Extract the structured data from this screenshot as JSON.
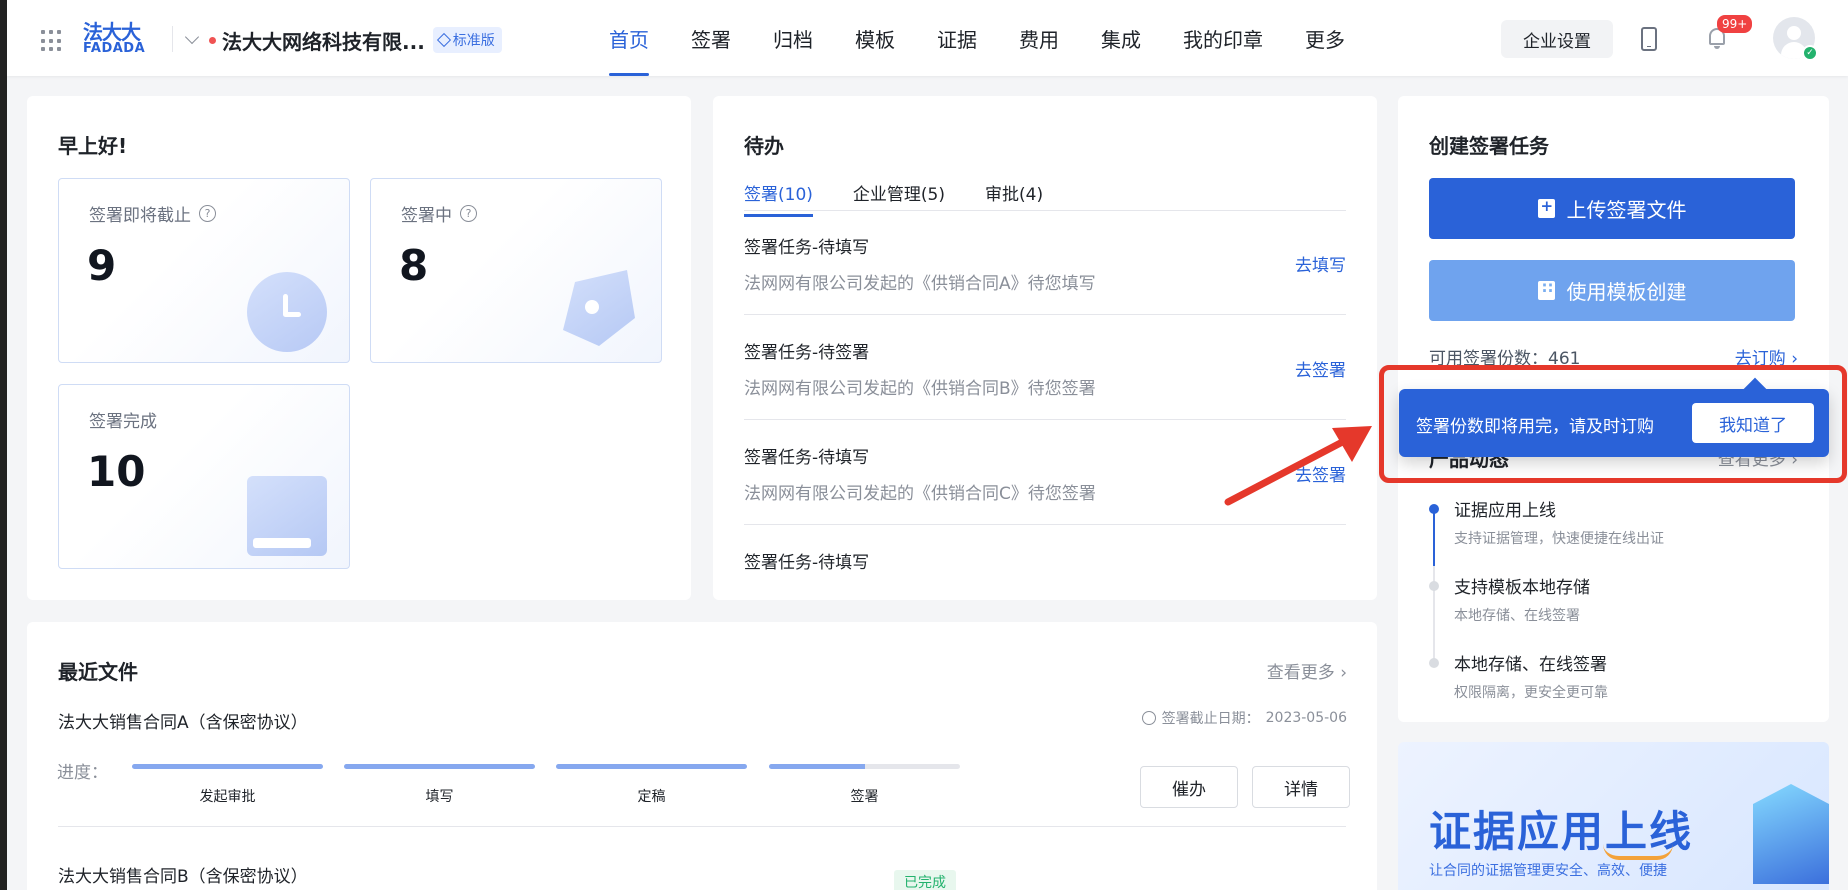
{
  "header": {
    "logo": {
      "cn": "法大大",
      "en": "FADADA"
    },
    "company_name": "法大大网络科技有限...",
    "edition_badge": "标准版",
    "nav": [
      {
        "label": "首页",
        "active": true
      },
      {
        "label": "签署",
        "active": false
      },
      {
        "label": "归档",
        "active": false
      },
      {
        "label": "模板",
        "active": false
      },
      {
        "label": "证据",
        "active": false
      },
      {
        "label": "费用",
        "active": false
      },
      {
        "label": "集成",
        "active": false
      },
      {
        "label": "我的印章",
        "active": false
      },
      {
        "label": "更多",
        "active": false
      }
    ],
    "settings_label": "企业设置",
    "notification_count": "99+"
  },
  "greeting": {
    "title": "早上好!",
    "stats": [
      {
        "label": "签署即将截止",
        "value": "9",
        "help": true
      },
      {
        "label": "签署中",
        "value": "8",
        "help": true
      },
      {
        "label": "签署完成",
        "value": "10",
        "help": false
      }
    ],
    "help_glyph": "?"
  },
  "todo": {
    "title": "待办",
    "tabs": [
      {
        "label": "签署(10)",
        "active": true
      },
      {
        "label": "企业管理(5)",
        "active": false
      },
      {
        "label": "审批(4)",
        "active": false
      }
    ],
    "items": [
      {
        "title": "签署任务-待填写",
        "desc": "法网网有限公司发起的《供销合同A》待您填写",
        "action": "去填写"
      },
      {
        "title": "签署任务-待签署",
        "desc": "法网网有限公司发起的《供销合同B》待您签署",
        "action": "去签署"
      },
      {
        "title": "签署任务-待填写",
        "desc": "法网网有限公司发起的《供销合同C》待您签署",
        "action": "去签署"
      },
      {
        "title": "签署任务-待填写",
        "desc": "",
        "action": ""
      }
    ]
  },
  "create": {
    "title": "创建签署任务",
    "upload_label": "上传签署文件",
    "template_label": "使用模板创建",
    "available_label": "可用签署份数：461",
    "order_link": "去订购",
    "popover_message": "签署份数即将用完，请及时订购",
    "popover_ok": "我知道了"
  },
  "news": {
    "title": "产品动态",
    "more_link": "查看更多",
    "items": [
      {
        "title": "证据应用上线",
        "desc": "支持证据管理，快速便捷在线出证",
        "active": true
      },
      {
        "title": "支持模板本地存储",
        "desc": "本地存储、在线签署",
        "active": false
      },
      {
        "title": "本地存储、在线签署",
        "desc": "权限隔离，更安全更可靠",
        "active": false
      }
    ]
  },
  "banner": {
    "title": "证据应用上线",
    "subtitle": "让合同的证据管理更安全、高效、便捷"
  },
  "recent": {
    "title": "最近文件",
    "more_link": "查看更多",
    "files": [
      {
        "name": "法大大销售合同A（含保密协议）",
        "deadline_label": "签署截止日期：",
        "deadline": "2023-05-06",
        "progress_label": "进度：",
        "steps": [
          {
            "label": "发起审批",
            "progress": 1.0
          },
          {
            "label": "填写",
            "progress": 1.0
          },
          {
            "label": "定稿",
            "progress": 1.0
          },
          {
            "label": "签署",
            "progress": 0.5
          }
        ],
        "buttons": [
          "催办",
          "详情"
        ]
      },
      {
        "name": "法大大销售合同B（含保密协议）",
        "status": "已完成"
      }
    ]
  },
  "colors": {
    "primary": "#2a62d8",
    "primary_light": "#6fa3ee",
    "alert_red": "#e5382b",
    "success": "#23b26d"
  }
}
